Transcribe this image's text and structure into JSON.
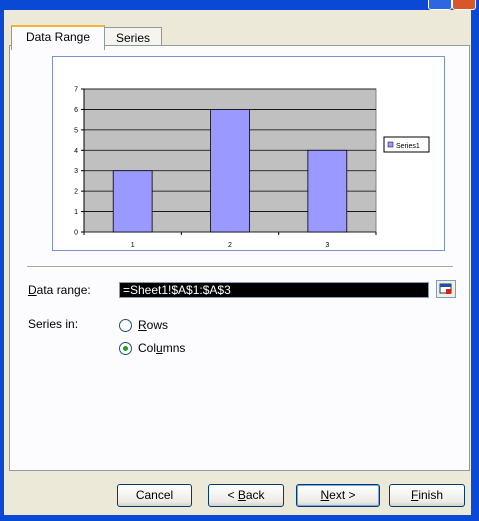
{
  "tabs": [
    {
      "label": "Data Range",
      "active": true
    },
    {
      "label": "Series",
      "active": false
    }
  ],
  "chart_data": {
    "type": "bar",
    "categories": [
      "1",
      "2",
      "3"
    ],
    "series": [
      {
        "name": "Series1",
        "values": [
          3,
          6,
          4
        ]
      }
    ],
    "ylim": [
      0,
      7
    ],
    "yticks": [
      0,
      1,
      2,
      3,
      4,
      5,
      6,
      7
    ],
    "grid": true,
    "legend": "right",
    "colors": {
      "bar": "#9999ff",
      "plot_area": "#c0c0c0"
    }
  },
  "data_range": {
    "label": "Data range:",
    "value": "=Sheet1!$A$1:$A$3"
  },
  "series_in": {
    "label": "Series in:",
    "options": [
      {
        "label": "Rows",
        "selected": false
      },
      {
        "label": "Columns",
        "selected": true
      }
    ]
  },
  "buttons": {
    "cancel": "Cancel",
    "back": "< Back",
    "next": "Next >",
    "finish": "Finish"
  }
}
